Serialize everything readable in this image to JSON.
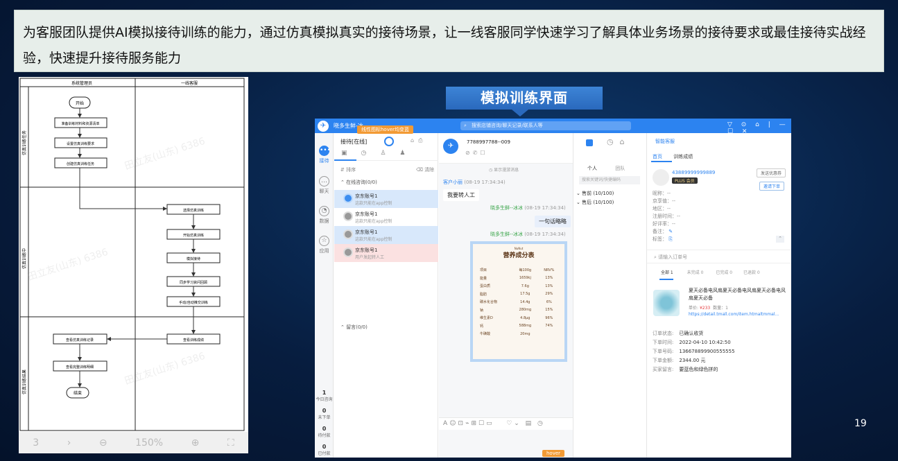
{
  "banner": {
    "text": "为客服团队提供AI模拟接待训练的能力，通过仿真模拟真实的接待场景，让一线客服同学快速学习了解具体业务场景的接待要求或最佳接待实战经验，快速提升接待服务能力"
  },
  "flowchart": {
    "lanes": [
      "系统管理员",
      "一线客服"
    ],
    "phases": [
      "仿真训练任务",
      "仿真训练中",
      "仿真训练结果"
    ],
    "nodes": {
      "start": "开始",
      "n1": "准备训练材料和资源清单",
      "n2": "设置仿真训练要求",
      "n3": "创建仿真训练任务",
      "n4": "选择仿真训练",
      "n5": "开始仿真训练",
      "n6": "模拟接待",
      "n7": "同步学习資问回顾",
      "n8": "手动/自动推交训练",
      "n9": "查看训练成绩",
      "n10": "查看仿真训练记录",
      "n11": "查看完整训练明细",
      "end": "结束"
    },
    "watermark": "田立友(山东) 6386",
    "footer": [
      "3",
      "›",
      "⊖",
      "150%",
      "⊕",
      "⛶"
    ]
  },
  "section_title": "模拟训练界面",
  "app": {
    "name": "晓多生鲜-冰",
    "hover_tip": "线性图标hover均变蓝",
    "search_placeholder": "搜索店铺咨询/聊天记录/联系人等",
    "window_controls": "▽ ⊙ ⌂ | — ☐ ✕",
    "nav": [
      {
        "label": "接待",
        "icon": "chat-icon"
      },
      {
        "label": "聊天",
        "icon": "message-icon"
      },
      {
        "label": "数据",
        "icon": "chart-icon"
      },
      {
        "label": "应用",
        "icon": "app-icon"
      }
    ],
    "stats": [
      {
        "value": "1",
        "label": "今日咨询"
      },
      {
        "value": "0",
        "label": "未下单"
      },
      {
        "value": "0",
        "label": "待付款"
      },
      {
        "value": "0",
        "label": "已付款"
      }
    ],
    "conv_header": {
      "title": "接待[在线]",
      "sort": "排序",
      "clear": "清除",
      "online": "在线咨询(0/0)",
      "messages": "留言(0/0)"
    },
    "conversations": [
      {
        "name": "京东账号1",
        "sub": "这款只能在app控制"
      },
      {
        "name": "京东账号1",
        "sub": "这款只能在app控制"
      },
      {
        "name": "京东账号1",
        "sub": "这款只能在app控制"
      },
      {
        "name": "京东账号1",
        "sub": "用户发起转人工"
      }
    ],
    "chat": {
      "contact": "7788997788--009",
      "history": "显示漫游消息",
      "customer": "客户小丽",
      "customer_time": "(08-19 17:34:34)",
      "customer_msg": "我要转人工",
      "agent": "晓多生鲜--冰冰",
      "agent_time": "(08-19 17:34:34)",
      "agent_msg": "一句话略略",
      "agent2_time": "(08-19 17:34:34)",
      "hover_badge": "hover"
    },
    "nutrition": {
      "brand": "NuNut",
      "title": "营养成分表",
      "headers": [
        "项目",
        "每100g",
        "NRV%"
      ],
      "rows": [
        [
          "能量",
          "1659kj",
          "13%"
        ],
        [
          "蛋白质",
          "7.6g",
          "13%"
        ],
        [
          "脂肪",
          "17.5g",
          "29%"
        ],
        [
          "碳水化合物",
          "14.4g",
          "6%"
        ],
        [
          "钠",
          "280mg",
          "15%"
        ],
        [
          "维生素D",
          "4.8μg",
          "96%"
        ],
        [
          "钙",
          "588mg",
          "74%"
        ],
        [
          "牛磺酸",
          "20mg",
          ""
        ]
      ]
    },
    "team": {
      "tab_personal": "个人",
      "tab_team": "团队",
      "search": "搜索关键词/快捷编码",
      "groups": [
        "售前 (10/100)",
        "售后 (10/100)"
      ]
    },
    "detail": {
      "title": "智能客服",
      "tabs": [
        "首页",
        "训练成绩"
      ],
      "user_id": "43889999999889",
      "plus": "PLUS 会员",
      "btn_coupon": "发送优惠券",
      "btn_order": "邀请下单",
      "fields": [
        "昵称：--",
        "京享值：--",
        "地区：--",
        "注册时间：--",
        "好评率：--",
        "备注：",
        "标签："
      ],
      "order_search": "请输入订单号",
      "order_tabs": [
        "全部 1",
        "未完成 0",
        "已完成 0",
        "已退款 0"
      ],
      "product_title": "夏天必备电风扇夏天必备电风扇夏天必备电风扇夏天必备",
      "price_label": "单价:",
      "price": "¥233",
      "qty": "数量：1",
      "product_link": "https://detail.tmall.com/item.htmaltmmal...",
      "order_fields": [
        [
          "订单状态:",
          "已确认收货"
        ],
        [
          "下单时间:",
          "2022-04-10 10:42:50"
        ],
        [
          "下单号码:",
          "136678899900555555"
        ],
        [
          "下单金额:",
          "2344.00 元"
        ],
        [
          "买家留言:",
          "要蓝色和绿色拼的"
        ]
      ]
    }
  },
  "page_number": "19"
}
